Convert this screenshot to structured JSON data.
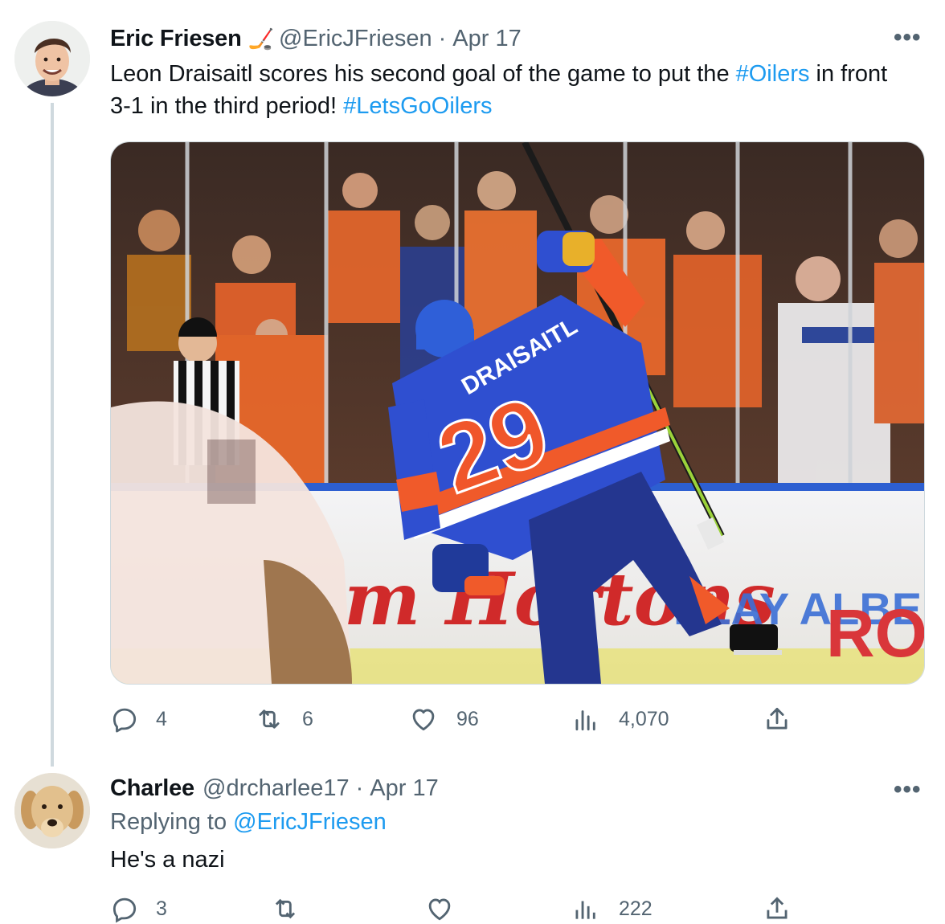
{
  "tweet": {
    "author_name": "Eric Friesen",
    "author_emoji": "🏒",
    "handle": "@EricJFriesen",
    "separator": "·",
    "date": "Apr 17",
    "text_before": "Leon Draisaitl scores his second goal of the game to put the ",
    "hashtag1": "#Oilers",
    "text_middle": " in front 3-1 in the third period! ",
    "hashtag2": "#LetsGoOilers",
    "more": "•••",
    "image": {
      "jersey_name": "DRAISAITL",
      "jersey_number": "29",
      "board_ad1": "m Hortons",
      "board_ad2": "PLAY ALBERTA",
      "board_ad3": "ROGERS"
    },
    "stats": {
      "replies": "4",
      "retweets": "6",
      "likes": "96",
      "views": "4,070"
    }
  },
  "reply": {
    "author_name": "Charlee",
    "handle": "@drcharlee17",
    "separator": "·",
    "date": "Apr 17",
    "replying_prefix": "Replying to ",
    "replying_to": "@EricJFriesen",
    "text": "He's a nazi",
    "more": "•••",
    "stats": {
      "replies": "3",
      "views": "222"
    }
  },
  "colors": {
    "link": "#1d9bf0",
    "secondary_text": "#536471",
    "oilers_blue": "#2f4fd0",
    "oilers_orange": "#f0562a"
  }
}
